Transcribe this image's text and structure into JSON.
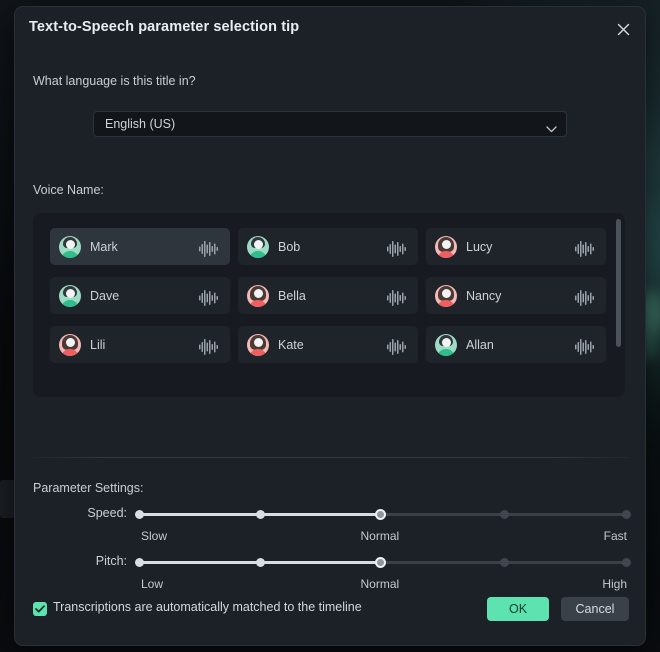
{
  "dialog": {
    "title": "Text-to-Speech parameter selection tip",
    "close_icon": "close-icon"
  },
  "language": {
    "question": "What language is this title in?",
    "selected": "English (US)",
    "caret_icon": "chevron-down-icon"
  },
  "voice": {
    "section_label": "Voice Name:",
    "items": [
      {
        "name": "Mark",
        "gender": "male",
        "selected": true
      },
      {
        "name": "Bob",
        "gender": "male",
        "selected": false
      },
      {
        "name": "Lucy",
        "gender": "female",
        "selected": false
      },
      {
        "name": "Dave",
        "gender": "male",
        "selected": false
      },
      {
        "name": "Bella",
        "gender": "female",
        "selected": false
      },
      {
        "name": "Nancy",
        "gender": "female",
        "selected": false
      },
      {
        "name": "Lili",
        "gender": "female",
        "selected": false
      },
      {
        "name": "Kate",
        "gender": "female",
        "selected": false
      },
      {
        "name": "Allan",
        "gender": "male",
        "selected": false
      }
    ],
    "preview_icon": "waveform-icon"
  },
  "parameters": {
    "section_label": "Parameter Settings:",
    "sliders": [
      {
        "caption": "Speed:",
        "value_index": 2,
        "steps": 5,
        "labels": {
          "min": "Slow",
          "mid": "Normal",
          "max": "Fast"
        }
      },
      {
        "caption": "Pitch:",
        "value_index": 2,
        "steps": 5,
        "labels": {
          "min": "Low",
          "mid": "Normal",
          "max": "High"
        }
      }
    ]
  },
  "footer": {
    "checkbox_label": "Transcriptions are automatically matched to the timeline",
    "checkbox_checked": true,
    "ok_label": "OK",
    "cancel_label": "Cancel"
  },
  "colors": {
    "accent": "#5de3b0",
    "dialog_bg": "#1c2127",
    "panel_bg": "#171b21",
    "card_bg": "#1f242b",
    "card_selected_bg": "#2e353d",
    "avatar_male": "#9ddbc4",
    "avatar_female": "#f6b8b8"
  }
}
